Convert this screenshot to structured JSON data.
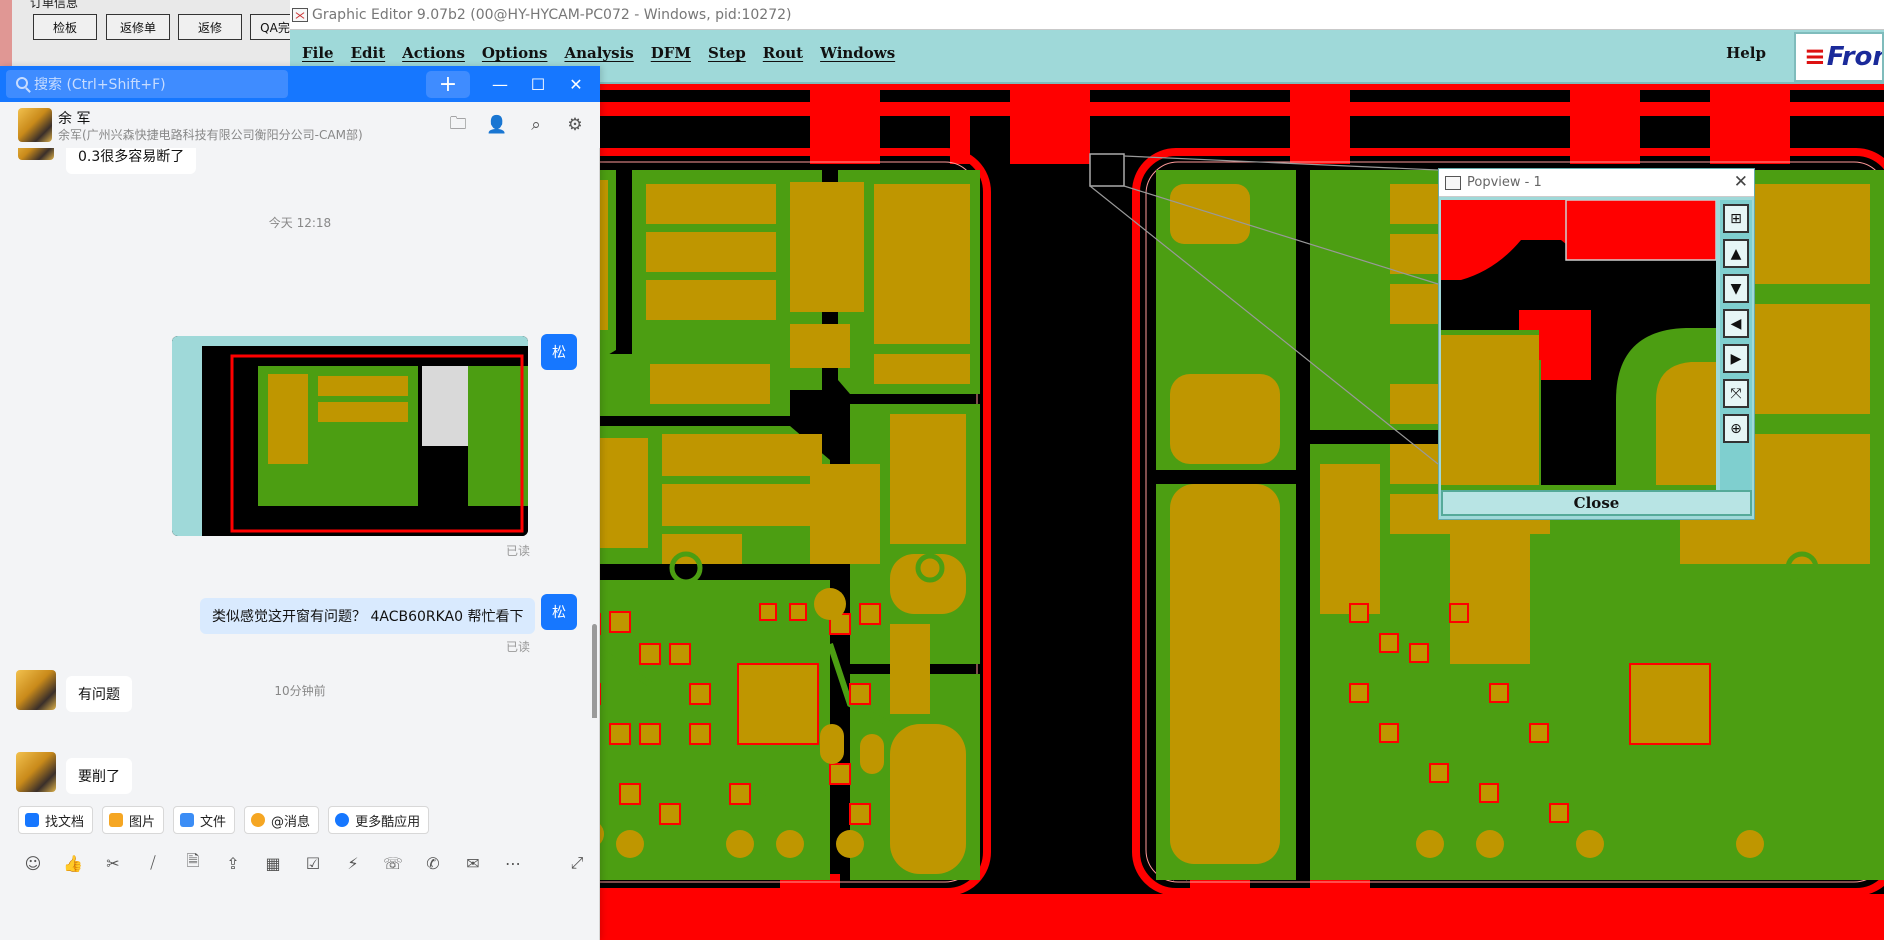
{
  "order_panel": {
    "title": "订单信息",
    "buttons": [
      "检板",
      "返修单",
      "返修",
      "QA完"
    ]
  },
  "graphic_editor": {
    "title": "Graphic Editor 9.07b2 (00@HY-HYCAM-PC072 - Windows, pid:10272)",
    "menu": [
      "File",
      "Edit",
      "Actions",
      "Options",
      "Analysis",
      "DFM",
      "Step",
      "Rout",
      "Windows"
    ],
    "help": "Help",
    "brand": "Fron"
  },
  "popview": {
    "title": "Popview - 1",
    "close_label": "Close",
    "tools": [
      "zoom-window-icon",
      "pan-up-icon",
      "pan-down-icon",
      "pan-left-icon",
      "pan-right-icon",
      "zoom-fit-icon",
      "zoom-home-icon"
    ]
  },
  "colors": {
    "board_green": "#4c9e12",
    "copper_gold": "#bf9600",
    "rout_red": "#ff0000",
    "canvas_black": "#000000",
    "menu_cyan": "#9fd9d9",
    "chat_blue": "#1677ff"
  },
  "chat": {
    "search_placeholder": "搜索 (Ctrl+Shift+F)",
    "contact_name": "余 军",
    "contact_org": "余军(广州兴森快捷电路科技有限公司衡阳分公司-CAM部)",
    "header_icons": [
      "folder-icon",
      "add-member-icon",
      "search-history-icon",
      "settings-icon"
    ],
    "messages": [
      {
        "side": "left",
        "text": "0.3很多容易断了"
      },
      {
        "type": "time",
        "text": "今天 12:18"
      },
      {
        "side": "right",
        "type": "image",
        "avatar": "松",
        "read": "已读"
      },
      {
        "side": "right",
        "text": "类似感觉这开窗有问题？ 4ACB60RKA0 帮忙看下",
        "avatar": "松",
        "read": "已读"
      },
      {
        "type": "time",
        "text": "10分钟前"
      },
      {
        "side": "left",
        "text": "有问题"
      },
      {
        "side": "left",
        "text": "要削了"
      }
    ],
    "quick_actions": [
      {
        "label": "找文档",
        "color": "#1677ff"
      },
      {
        "label": "图片",
        "color": "#f5a623"
      },
      {
        "label": "文件",
        "color": "#3b8df5"
      },
      {
        "label": "@消息",
        "color": "#f5a623"
      },
      {
        "label": "更多酷应用",
        "color": "#1677ff"
      }
    ],
    "toolbar": [
      "emoji-icon",
      "thumbs-up-icon",
      "scissors-icon",
      "slash-command-icon",
      "doc-icon",
      "upload-icon",
      "calendar-icon",
      "todo-icon",
      "flash-icon",
      "phone-icon",
      "call-icon",
      "mail-icon",
      "more-icon"
    ]
  }
}
